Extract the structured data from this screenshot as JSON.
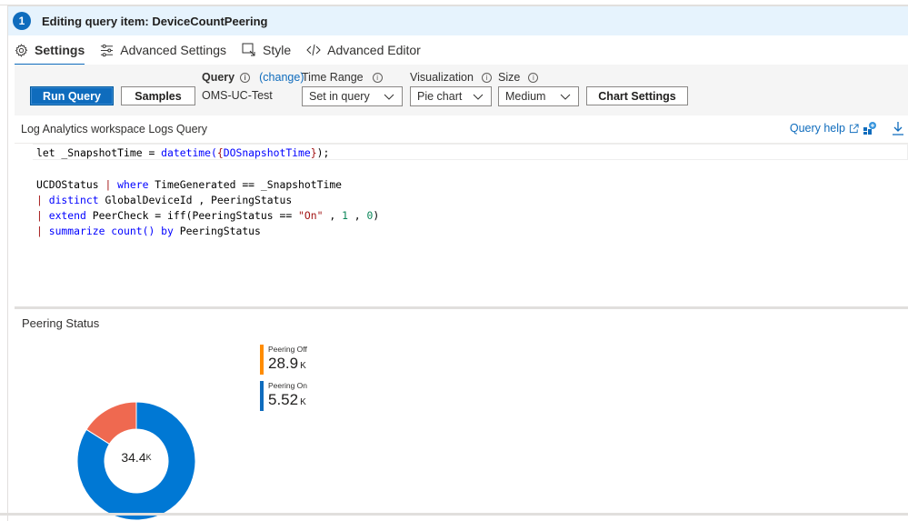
{
  "header": {
    "step_number": "1",
    "title": "Editing query item: DeviceCountPeering"
  },
  "tabs": [
    {
      "label": "Settings",
      "icon": "gear-icon",
      "active": true
    },
    {
      "label": "Advanced Settings",
      "icon": "sliders-icon",
      "active": false
    },
    {
      "label": "Style",
      "icon": "style-cursor-icon",
      "active": false
    },
    {
      "label": "Advanced Editor",
      "icon": "code-icon",
      "active": false
    }
  ],
  "toolbar": {
    "run_query_label": "Run Query",
    "samples_label": "Samples",
    "query_label": "Query",
    "query_change_label": "(change)",
    "query_value": "OMS-UC-Test",
    "time_range_label": "Time Range",
    "time_range_value": "Set in query",
    "visualization_label": "Visualization",
    "visualization_value": "Pie chart",
    "size_label": "Size",
    "size_value": "Medium",
    "chart_settings_label": "Chart Settings"
  },
  "query_section": {
    "title": "Log Analytics workspace Logs Query",
    "help_label": "Query help"
  },
  "editor": {
    "lines": [
      "let _SnapshotTime = datetime({DOSnapshotTime});",
      "",
      "UCDOStatus | where TimeGenerated == _SnapshotTime",
      "| distinct GlobalDeviceId , PeeringStatus",
      "| extend PeerCheck = iff(PeeringStatus == \"On\" , 1 , 0)",
      "| summarize count() by PeeringStatus"
    ]
  },
  "chart_data": {
    "type": "pie",
    "variant": "donut",
    "title": "Peering Status",
    "center_label": "34.4",
    "center_unit": "K",
    "legend_placement": "right",
    "series": [
      {
        "name": "Peering Off",
        "display_value": "28.9",
        "unit": "K",
        "value": 28900,
        "legend_color": "#ff8c00",
        "slice_color": "#0078d4"
      },
      {
        "name": "Peering On",
        "display_value": "5.52",
        "unit": "K",
        "value": 5520,
        "legend_color": "#0f6cbd",
        "slice_color": "#ef6950"
      }
    ]
  },
  "colors": {
    "accent": "#0f6cbd",
    "header_bg": "#e6f3fd",
    "toolbar_bg": "#f5f5f5"
  }
}
